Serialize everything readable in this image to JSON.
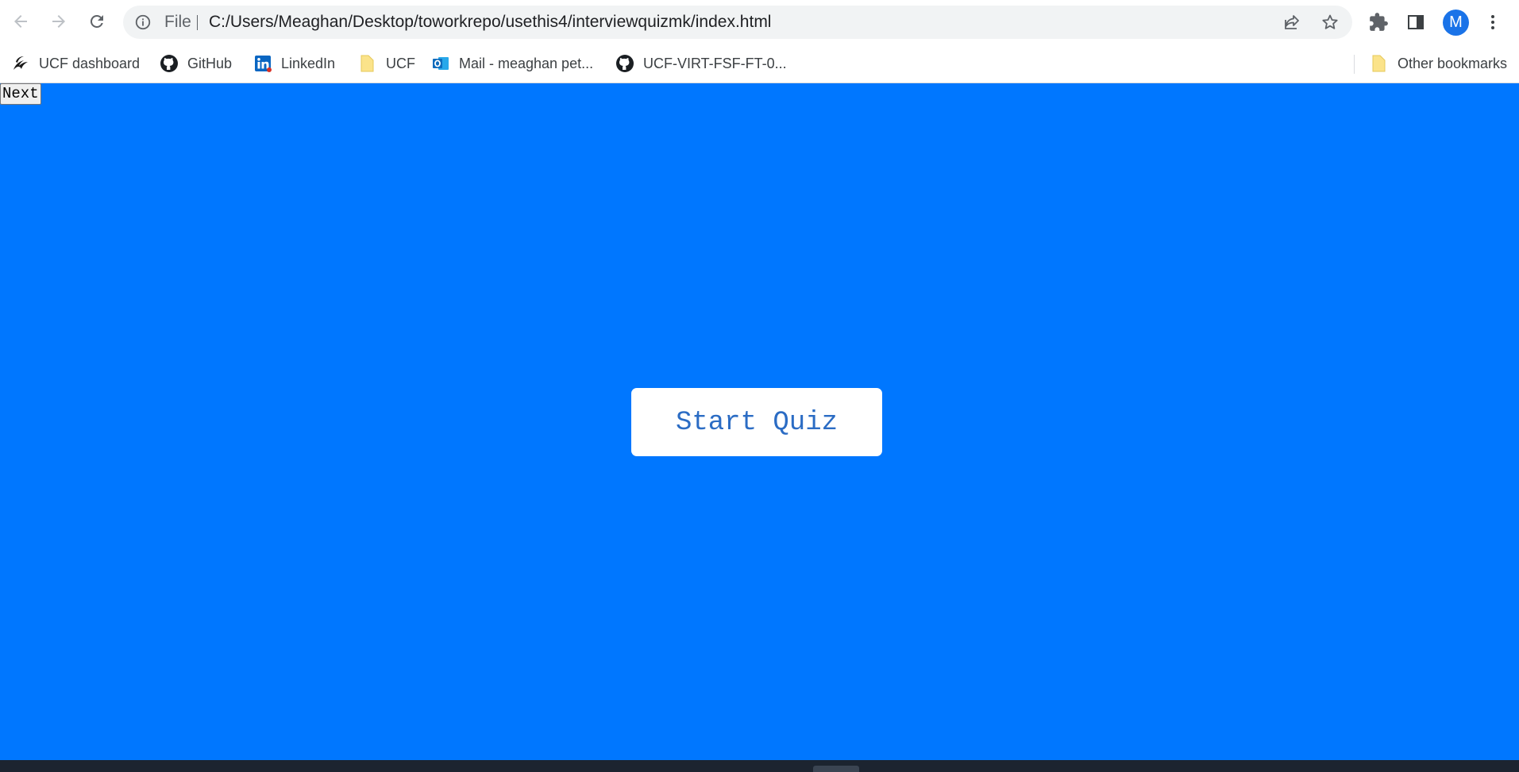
{
  "browser": {
    "omnibox": {
      "scheme_label": "File",
      "url": "C:/Users/Meaghan/Desktop/toworkrepo/usethis4/interviewquizmk/index.html"
    },
    "profile_initial": "M",
    "icons": {
      "back": "arrow-left-icon",
      "forward": "arrow-right-icon",
      "reload": "reload-icon",
      "info": "info-icon",
      "share": "share-icon",
      "bookmark_star": "star-icon",
      "extensions": "puzzle-icon",
      "side_panel": "side-panel-icon",
      "menu": "kebab-menu-icon"
    }
  },
  "bookmarks": [
    {
      "label": "UCF dashboard",
      "icon": "ucf-pegasus-icon"
    },
    {
      "label": "GitHub",
      "icon": "github-icon"
    },
    {
      "label": "LinkedIn",
      "icon": "linkedin-icon"
    },
    {
      "label": "UCF",
      "icon": "folder-icon"
    },
    {
      "label": "Mail - meaghan pet...",
      "icon": "outlook-icon"
    },
    {
      "label": "UCF-VIRT-FSF-FT-0...",
      "icon": "github-icon"
    }
  ],
  "other_bookmarks": {
    "label": "Other bookmarks",
    "icon": "folder-icon"
  },
  "page": {
    "next_button": "Next",
    "start_button": "Start Quiz",
    "background_color": "#0077ff",
    "start_text_color": "#2b6cc4"
  }
}
